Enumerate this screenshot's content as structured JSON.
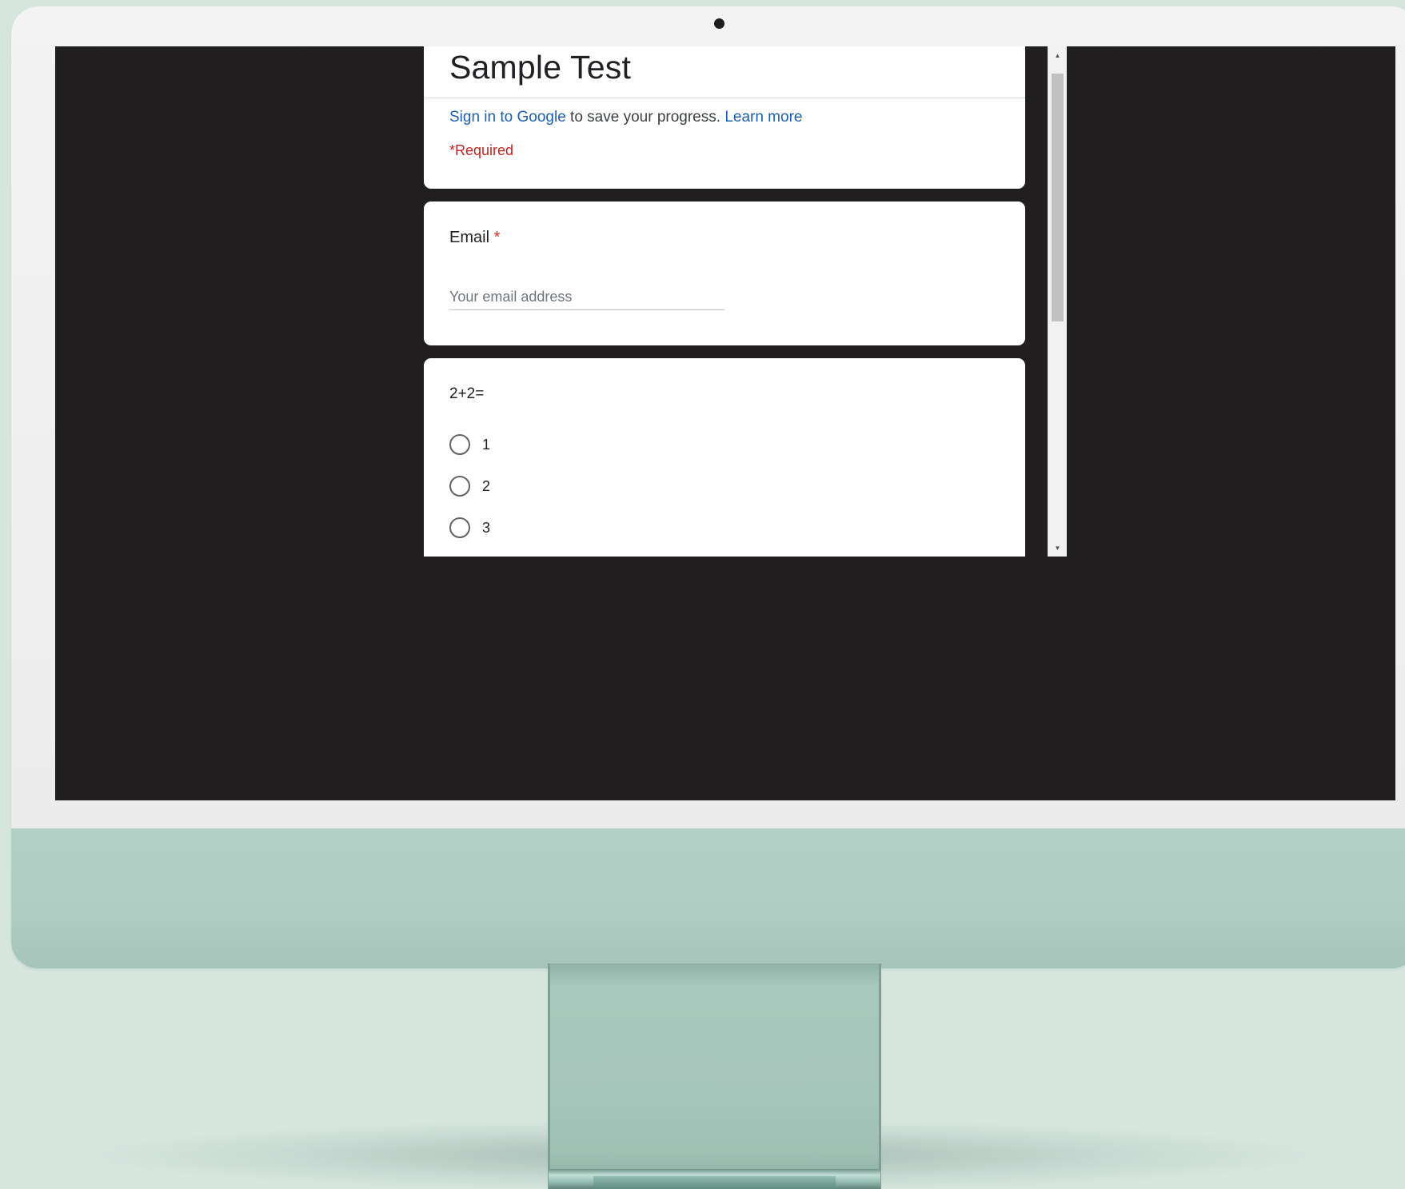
{
  "form": {
    "title": "Sample Test",
    "signin_link": "Sign in to Google",
    "signin_text": " to save your progress. ",
    "learn_more": "Learn more",
    "required_note": "*Required"
  },
  "email_question": {
    "label": "Email",
    "required_mark": "*",
    "placeholder": "Your email address",
    "value": ""
  },
  "math_question": {
    "text": "2+2=",
    "options": [
      "1",
      "2",
      "3"
    ]
  },
  "scrollbar": {
    "up_arrow_icon": "triangle-up-icon",
    "down_arrow_icon": "triangle-down-icon",
    "up_glyph": "▲",
    "down_glyph": "▼"
  },
  "colors": {
    "link": "#1a5fb4",
    "required": "#c5221f",
    "screen_bg": "#201e1e",
    "monitor_body": "#b1cec5"
  }
}
